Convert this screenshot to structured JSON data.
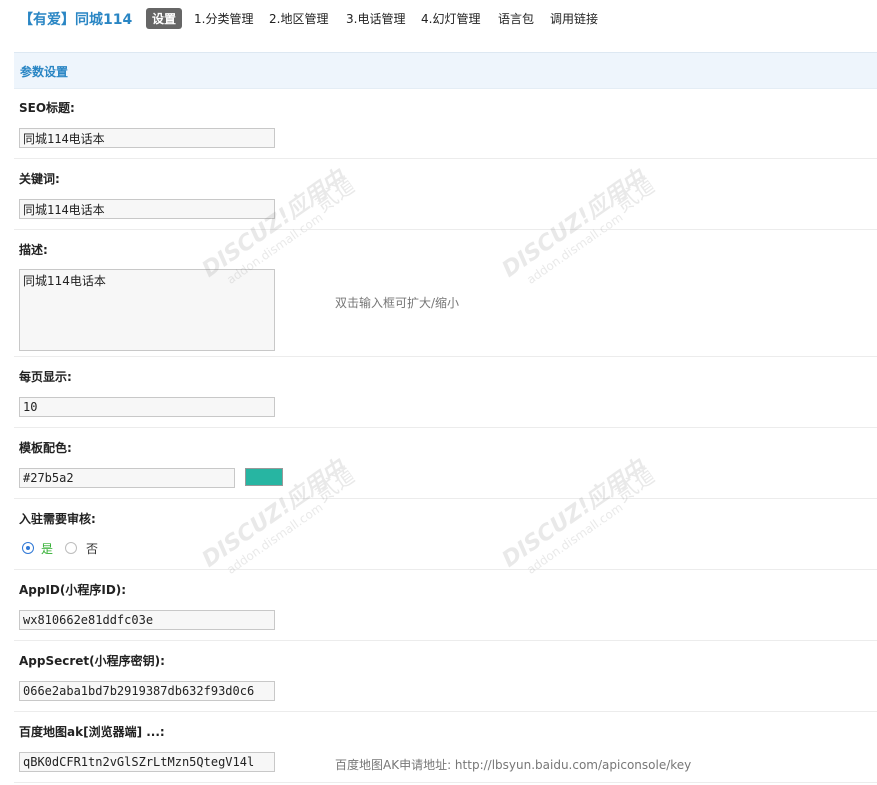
{
  "header": {
    "brand": "【有爱】同城114",
    "tabs": [
      {
        "label": "设置",
        "active": true
      },
      {
        "label": "1.分类管理"
      },
      {
        "label": "2.地区管理"
      },
      {
        "label": "3.电话管理"
      },
      {
        "label": "4.幻灯管理"
      },
      {
        "label": "语言包"
      },
      {
        "label": "调用链接"
      }
    ]
  },
  "section": {
    "title": "参数设置"
  },
  "form": {
    "seo_title": {
      "label": "SEO标题:",
      "value": "同城114电话本"
    },
    "keywords": {
      "label": "关键词:",
      "value": "同城114电话本"
    },
    "description": {
      "label": "描述:",
      "value": "同城114电话本",
      "hint": "双击输入框可扩大/缩小"
    },
    "per_page": {
      "label": "每页显示:",
      "value": "10"
    },
    "theme_color": {
      "label": "模板配色:",
      "value": "#27b5a2",
      "swatch": "#27b5a2"
    },
    "review": {
      "label": "入驻需要审核:",
      "yes": "是",
      "no": "否",
      "selected": "yes"
    },
    "appid": {
      "label": "AppID(小程序ID):",
      "value": "wx810662e81ddfc03e"
    },
    "appsecret": {
      "label": "AppSecret(小程序密钥):",
      "value": "066e2aba1bd7b2919387db632f93d0c6"
    },
    "baidu_ak": {
      "label": "百度地图ak[浏览器端] ...:",
      "value": "qBK0dCFR1tn2vGlSZrLtMzn5QtegV14l",
      "hint": "百度地图AK申请地址:  http://lbsyun.baidu.com/apiconsole/key"
    }
  },
  "colors": {
    "accent": "#2a86c4",
    "radio": "#2f78d6",
    "section_bg": "#eef5fc",
    "yes_text": "#2fae2f"
  },
  "watermark": {
    "text1": "DISCUZ!应用中心",
    "text2": "addon.dismall.com",
    "text3": "贰道"
  }
}
